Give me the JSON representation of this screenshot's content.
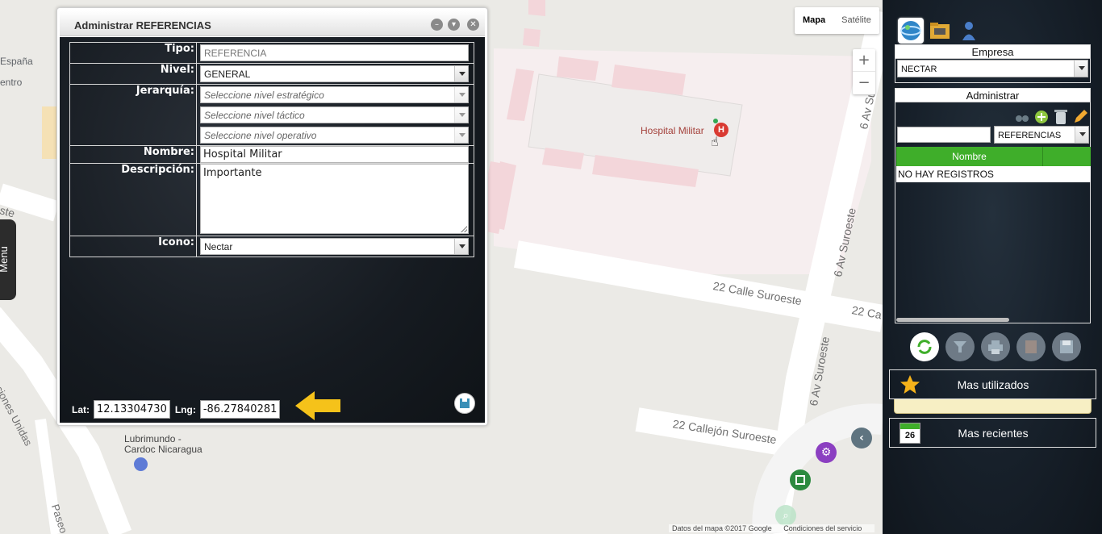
{
  "map": {
    "type_buttons": [
      "Mapa",
      "Satélite"
    ],
    "zoom_in": "+",
    "zoom_out": "−",
    "labels": {
      "espana": "España",
      "centro": "entro",
      "este_left": "ste",
      "hospital": "Hospital Militar",
      "calle22": "22 Calle Suroeste",
      "calle22b": "22 Ca",
      "av6_top": "6 Av Su",
      "av6_mid": "6 Av Suroeste",
      "av6_low": "6 Av Suroeste",
      "callejon": "22 Callejón Suroeste",
      "naciones": "ciones Unidas",
      "paseo": "Paseo N",
      "lubrimundo": "Lubrimundo -",
      "cardoc": "Cardoc Nicaragua"
    },
    "attribution": {
      "data": "Datos del mapa ©2017 Google",
      "terms": "Condiciones del servicio"
    }
  },
  "side_menu": {
    "label": "Menu"
  },
  "dialog": {
    "title": "Administrar REFERENCIAS",
    "fields": {
      "tipo": {
        "label": "Tipo:",
        "value": "REFERENCIA"
      },
      "nivel": {
        "label": "Nivel:",
        "value": "GENERAL"
      },
      "jerarquia": {
        "label": "Jerarquía:",
        "estrategico": "Seleccione nivel estratégico",
        "tactico": "Seleccione nivel táctico",
        "operativo": "Seleccione nivel operativo"
      },
      "nombre": {
        "label": "Nombre:",
        "value": "Hospital Militar"
      },
      "descripcion": {
        "label": "Descripción:",
        "value": "Importante"
      },
      "icono": {
        "label": "Icono:",
        "value": "Nectar"
      }
    },
    "coords": {
      "lat_label": "Lat:",
      "lat": "12.13304730",
      "lng_label": "Lng:",
      "lng": "-86.27840281"
    }
  },
  "panel": {
    "empresa": {
      "title": "Empresa",
      "value": "NECTAR"
    },
    "administrar": {
      "title": "Administrar",
      "search_value": "",
      "type_value": "REFERENCIAS",
      "column": "Nombre",
      "empty_row": "NO HAY REGISTROS"
    },
    "mas_utilizados": "Mas utilizados",
    "mas_recientes": "Mas recientes",
    "calendar_day": "26"
  },
  "colors": {
    "accent_green": "#3fae2a",
    "warning_yellow": "#f5c21a",
    "hospital_red": "#d93a32"
  }
}
